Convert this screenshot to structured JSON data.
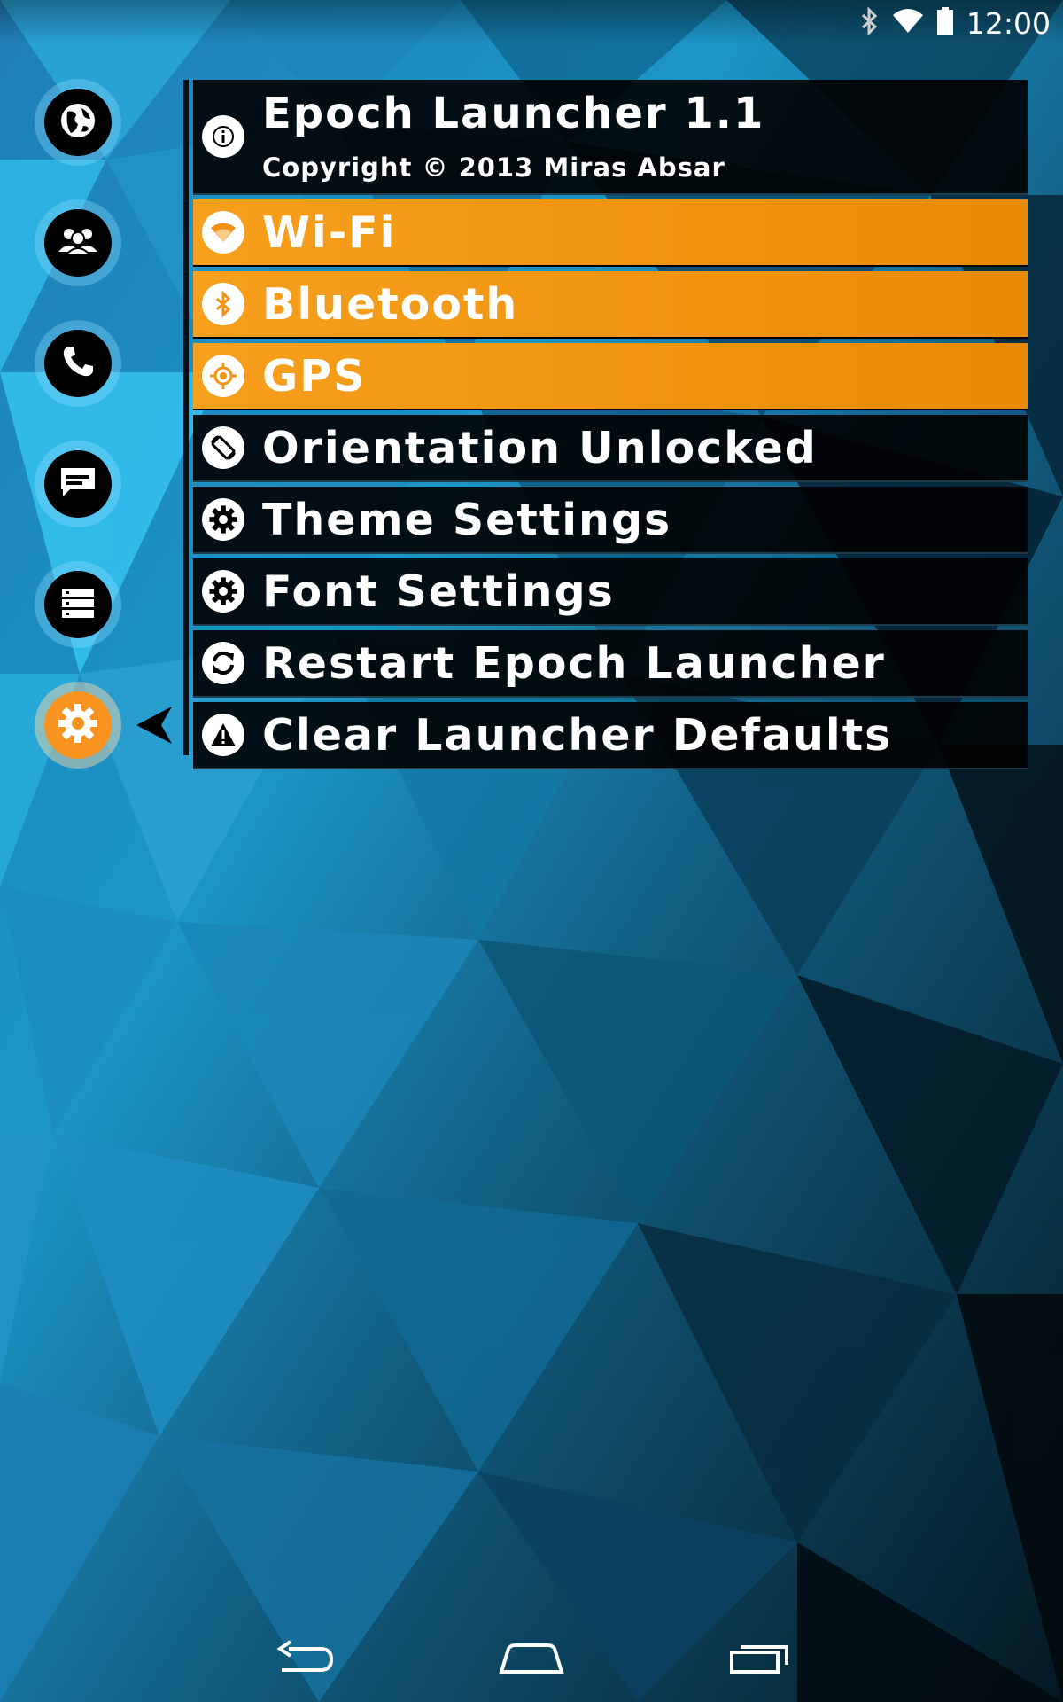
{
  "status_bar": {
    "time": "12:00",
    "icons": [
      "bluetooth-icon",
      "wifi-icon",
      "battery-icon"
    ]
  },
  "dock": {
    "items": [
      {
        "icon": "globe-icon",
        "active": false
      },
      {
        "icon": "people-icon",
        "active": false
      },
      {
        "icon": "phone-icon",
        "active": false
      },
      {
        "icon": "message-icon",
        "active": false
      },
      {
        "icon": "list-icon",
        "active": false
      },
      {
        "icon": "gear-icon",
        "active": true
      }
    ]
  },
  "panel": {
    "header": {
      "title": "Epoch Launcher 1.1",
      "copyright": "Copyright © 2013 Miras Absar",
      "icon": "info-icon"
    },
    "items": [
      {
        "label": "Wi-Fi",
        "icon": "wifi-icon",
        "on": true
      },
      {
        "label": "Bluetooth",
        "icon": "bluetooth-icon",
        "on": true
      },
      {
        "label": "GPS",
        "icon": "gps-icon",
        "on": true
      },
      {
        "label": "Orientation Unlocked",
        "icon": "rotation-icon",
        "on": false
      },
      {
        "label": "Theme Settings",
        "icon": "gear-icon",
        "on": false
      },
      {
        "label": "Font Settings",
        "icon": "gear-icon",
        "on": false
      },
      {
        "label": "Restart Epoch Launcher",
        "icon": "refresh-icon",
        "on": false
      },
      {
        "label": "Clear Launcher Defaults",
        "icon": "warning-icon",
        "on": false
      }
    ]
  },
  "colors": {
    "accent": "#f7931e",
    "panel_bg": "#000000",
    "text": "#ffffff"
  },
  "nav_bar": {
    "buttons": [
      "back-icon",
      "home-icon",
      "recents-icon"
    ]
  }
}
